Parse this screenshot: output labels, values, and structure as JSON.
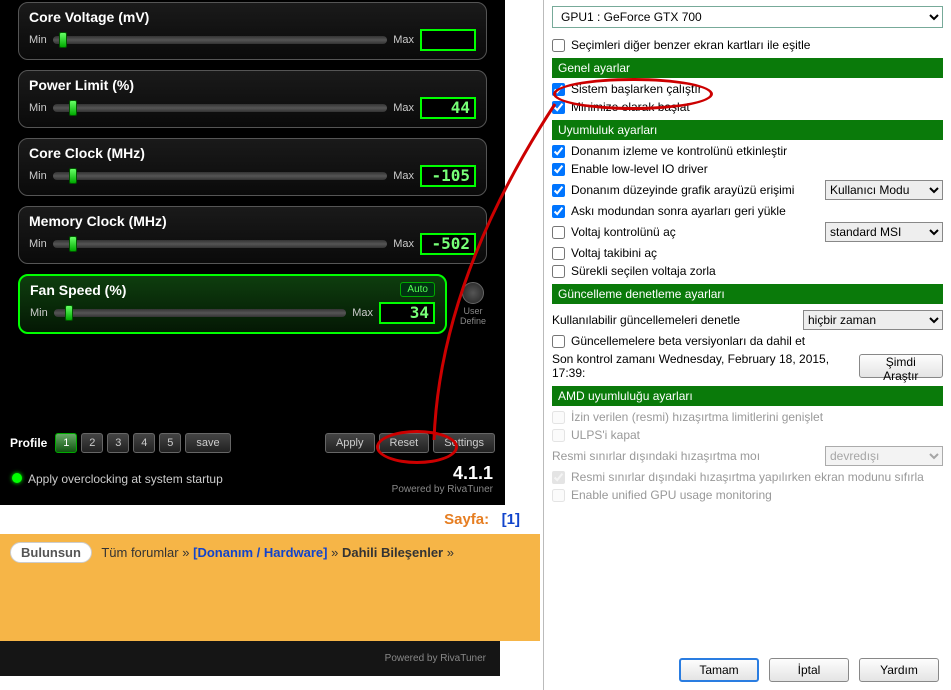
{
  "left": {
    "sliders": [
      {
        "title": "Core Voltage (mV)",
        "value": "",
        "thumb": 2
      },
      {
        "title": "Power Limit (%)",
        "value": "44",
        "thumb": 5
      },
      {
        "title": "Core Clock (MHz)",
        "value": "-105",
        "thumb": 5
      },
      {
        "title": "Memory Clock (MHz)",
        "value": "-502",
        "thumb": 5
      },
      {
        "title": "Fan Speed (%)",
        "value": "34",
        "thumb": 4,
        "active": true,
        "auto": "Auto"
      }
    ],
    "min": "Min",
    "max": "Max",
    "user_define": "User Define",
    "profile_label": "Profile",
    "profiles": [
      "1",
      "2",
      "3",
      "4",
      "5"
    ],
    "save": "save",
    "apply": "Apply",
    "reset": "Reset",
    "settings": "Settings",
    "startup_label": "Apply overclocking at system startup",
    "version": "4.1.1",
    "powered": "Powered by RivaTuner"
  },
  "forum": {
    "sayfa_label": "Sayfa:",
    "page": "[1]",
    "prev": "Bulunsun",
    "all": "Tüm forumlar",
    "sep": "»",
    "hw": "[Donanım / Hardware]",
    "dahili": "Dahili Bileşenler",
    "riva": "Powered by RivaTuner"
  },
  "right": {
    "gpu": "GPU1 : GeForce GTX 700",
    "sync": "Seçimleri diğer benzer ekran kartları ile eşitle",
    "sec_general": "Genel ayarlar",
    "start_win": "Sistem başlarken çalıştır",
    "start_min": "Minimize olarak başlat",
    "sec_compat": "Uyumluluk ayarları",
    "hw_mon": "Donanım izleme ve kontrolünü etkinleştir",
    "low_io": "Enable low-level IO driver",
    "hw_gfx": "Donanım düzeyinde grafik arayüzü erişimi",
    "hw_gfx_opt": "Kullanıcı Modu",
    "restore": "Askı modundan sonra ayarları geri yükle",
    "volt_ctrl": "Voltaj kontrolünü aç",
    "volt_opt": "standard MSI",
    "volt_mon": "Voltaj takibini aç",
    "force_volt": "Sürekli seçilen voltaja zorla",
    "sec_update": "Güncelleme denetleme ayarları",
    "check_label": "Kullanılabilir güncellemeleri denetle",
    "check_opt": "hiçbir zaman",
    "beta": "Güncellemelere beta versiyonları da dahil et",
    "last_check": "Son kontrol zamanı Wednesday, February 18, 2015, 17:39:",
    "check_now": "Şimdi Araştır",
    "sec_amd": "AMD uyumluluğu ayarları",
    "amd_ext": "İzin verilen (resmi) hızaşırtma limitlerini genişlet",
    "ulps": "ULPS'i kapat",
    "unoff_mode": "Resmi sınırlar dışındaki hızaşırtma moı",
    "unoff_opt": "devredışı",
    "reset_disp": "Resmi sınırlar dışındaki hızaşırtma yapılırken ekran modunu sıfırla",
    "unified": "Enable unified GPU usage monitoring",
    "ok": "Tamam",
    "cancel": "İptal",
    "help": "Yardım"
  }
}
